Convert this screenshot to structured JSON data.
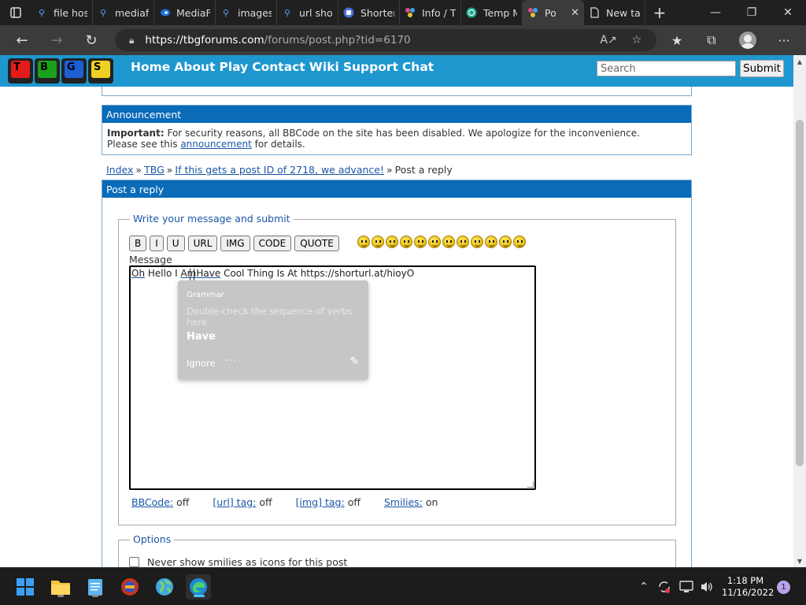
{
  "browser": {
    "tabs": [
      {
        "title": "file hos",
        "icon": "search-icon"
      },
      {
        "title": "mediaf",
        "icon": "search-icon"
      },
      {
        "title": "MediaF",
        "icon": "mediafire-icon"
      },
      {
        "title": "images",
        "icon": "search-icon"
      },
      {
        "title": "url shor",
        "icon": "search-icon"
      },
      {
        "title": "Shorter",
        "icon": "shortener-icon"
      },
      {
        "title": "Info / T",
        "icon": "tbg-icon"
      },
      {
        "title": "Temp M",
        "icon": "tempmail-icon"
      },
      {
        "title": "Po",
        "icon": "tbg-icon",
        "active": true
      },
      {
        "title": "New ta",
        "icon": "page-icon"
      }
    ],
    "url_host": "https://tbgforums.com",
    "url_path": "/forums/post.php?tid=6170"
  },
  "site": {
    "logo_letters": [
      "T",
      "B",
      "G",
      "S"
    ],
    "nav": [
      "Home",
      "About",
      "Play",
      "Contact",
      "Wiki",
      "Support",
      "Chat"
    ],
    "search_placeholder": "Search",
    "submit_label": "Submit"
  },
  "announcement": {
    "heading": "Announcement",
    "important_label": "Important:",
    "line1": "For security reasons, all BBCode on the site has been disabled. We apologize for the inconvenience.",
    "line2_pre": "Please see this",
    "line2_link": "announcement",
    "line2_post": "for details."
  },
  "breadcrumbs": {
    "items": [
      "Index",
      "TBG",
      "If this gets a post ID of 2718, we advance!"
    ],
    "current": "Post a reply",
    "separator": "»"
  },
  "post": {
    "heading": "Post a reply",
    "legend": "Write your message and submit",
    "bbcode_buttons": [
      "B",
      "I",
      "U",
      "URL",
      "IMG",
      "CODE",
      "QUOTE"
    ],
    "smilies_count": 12,
    "message_label": "Message",
    "message_words": {
      "w1": "Oh",
      "w2": " Hello I ",
      "w3": "Am",
      "w4": "Have",
      "w5": " Cool Thing Is At https://shorturl.at/hioyO"
    },
    "grammar": {
      "title": "Grammar",
      "description": "Double-check the sequence of verbs here",
      "suggestion": "Have",
      "ignore": "Ignore",
      "more": "···"
    },
    "flags": [
      {
        "key": "BBCode:",
        "value": "off"
      },
      {
        "key": "[url] tag:",
        "value": "off"
      },
      {
        "key": "[img] tag:",
        "value": "off"
      },
      {
        "key": "Smilies:",
        "value": "on"
      }
    ],
    "options_legend": "Options",
    "option_never_smilies": "Never show smilies as icons for this post"
  },
  "taskbar": {
    "time": "1:18 PM",
    "date": "11/16/2022",
    "notification_count": "1"
  }
}
